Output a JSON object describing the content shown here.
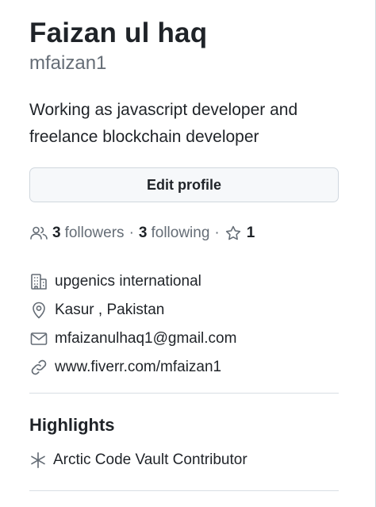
{
  "profile": {
    "name": "Faizan ul haq",
    "username": "mfaizan1",
    "bio": "Working as javascript developer and freelance blockchain developer",
    "edit_button": "Edit profile"
  },
  "social": {
    "followers_count": "3",
    "followers_label": "followers",
    "separator": "·",
    "following_count": "3",
    "following_label": "following",
    "stars_count": "1"
  },
  "details": {
    "company": "upgenics international",
    "location": "Kasur , Pakistan",
    "email": "mfaizanulhaq1@gmail.com",
    "website": "www.fiverr.com/mfaizan1"
  },
  "highlights": {
    "title": "Highlights",
    "items": [
      {
        "label": "Arctic Code Vault Contributor",
        "icon": "snowflake-icon"
      }
    ]
  },
  "icons": {
    "people": "people-icon",
    "star": "star-icon",
    "company": "building-icon",
    "location": "location-pin-icon",
    "email": "mail-icon",
    "website": "link-icon"
  },
  "colors": {
    "text": "#1f2328",
    "muted": "#656d76",
    "border": "#d0d7de",
    "button_bg": "#f6f8fa"
  }
}
